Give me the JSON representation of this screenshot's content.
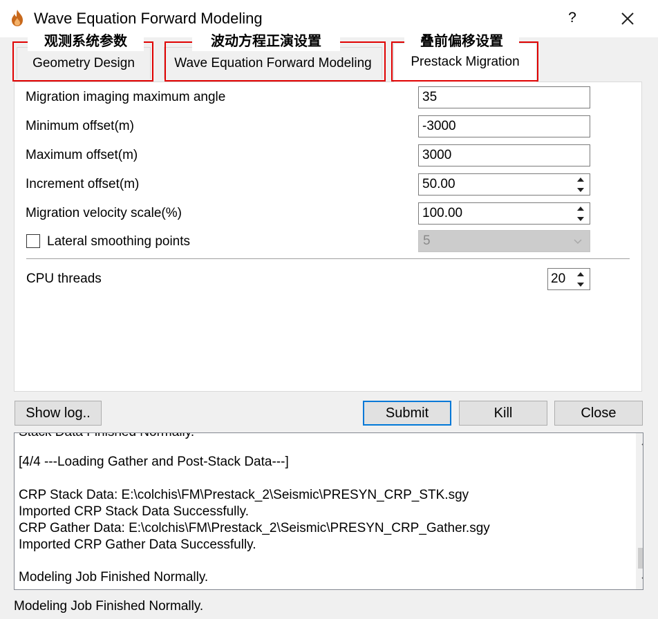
{
  "window": {
    "title": "Wave Equation Forward Modeling",
    "help_label": "?",
    "icon": "flame-icon",
    "close_icon": "close-icon"
  },
  "tabs": [
    {
      "label": "Geometry Design",
      "annotation": "观测系统参数"
    },
    {
      "label": "Wave Equation Forward Modeling",
      "annotation": "波动方程正演设置"
    },
    {
      "label": "Prestack Migration",
      "annotation": "叠前偏移设置",
      "active": true
    }
  ],
  "annotation_color": "#e00000",
  "form": {
    "max_angle": {
      "label": "Migration imaging maximum angle",
      "value": "35"
    },
    "min_offset": {
      "label": "Minimum offset(m)",
      "value": "-3000"
    },
    "max_offset": {
      "label": "Maximum offset(m)",
      "value": "3000"
    },
    "increment_offset": {
      "label": "Increment offset(m)",
      "value": "50.00"
    },
    "velocity_scale": {
      "label": "Migration velocity scale(%)",
      "value": "100.00"
    },
    "lateral_smoothing": {
      "label": "Lateral smoothing points",
      "checked": false,
      "value": "5",
      "disabled": true
    },
    "cpu_threads": {
      "label": "CPU threads",
      "value": "20"
    }
  },
  "buttons": {
    "show_log": "Show log..",
    "submit": "Submit",
    "kill": "Kill",
    "close": "Close"
  },
  "log": {
    "partial_line": "Stack Data Finished Normally.",
    "lines": [
      "[4/4 ---Loading Gather and Post-Stack Data---]",
      "CRP Stack Data: E:\\colchis\\FM\\Prestack_2\\Seismic\\PRESYN_CRP_STK.sgy",
      "Imported CRP Stack Data Successfully.",
      "CRP Gather Data: E:\\colchis\\FM\\Prestack_2\\Seismic\\PRESYN_CRP_Gather.sgy",
      "Imported CRP Gather Data Successfully.",
      "Modeling Job Finished Normally."
    ]
  },
  "status_bar": "Modeling Job Finished Normally."
}
